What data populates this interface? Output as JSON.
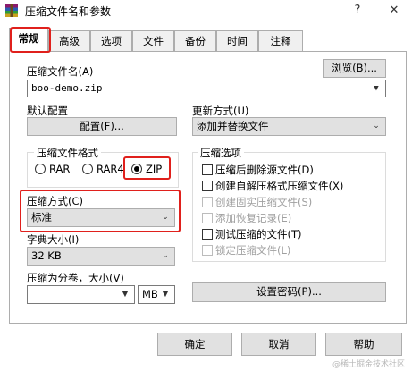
{
  "window": {
    "title": "压缩文件名和参数",
    "help_glyph": "?",
    "close_glyph": "✕"
  },
  "tabs": [
    {
      "label": "常规",
      "active": true
    },
    {
      "label": "高级"
    },
    {
      "label": "选项"
    },
    {
      "label": "文件"
    },
    {
      "label": "备份"
    },
    {
      "label": "时间"
    },
    {
      "label": "注释"
    }
  ],
  "archive_name": {
    "label": "压缩文件名(A)",
    "value": "boo-demo.zip",
    "browse_label": "浏览(B)..."
  },
  "default_profile": {
    "label": "默认配置",
    "profiles_button": "配置(F)..."
  },
  "update_mode": {
    "label": "更新方式(U)",
    "value": "添加并替换文件"
  },
  "archive_format": {
    "title": "压缩文件格式",
    "options": [
      {
        "label": "RAR",
        "selected": false
      },
      {
        "label": "RAR4",
        "selected": false
      },
      {
        "label": "ZIP",
        "selected": true
      }
    ]
  },
  "compression_method": {
    "label": "压缩方式(C)",
    "value": "标准"
  },
  "dictionary_size": {
    "label": "字典大小(I)",
    "value": "32 KB"
  },
  "split_volumes": {
    "label": "压缩为分卷，大小(V)",
    "value": "",
    "unit": "MB"
  },
  "archive_options": {
    "title": "压缩选项",
    "items": [
      {
        "label": "压缩后删除源文件(D)",
        "checked": false,
        "enabled": true
      },
      {
        "label": "创建自解压格式压缩文件(X)",
        "checked": false,
        "enabled": true
      },
      {
        "label": "创建固实压缩文件(S)",
        "checked": false,
        "enabled": false
      },
      {
        "label": "添加恢复记录(E)",
        "checked": false,
        "enabled": false
      },
      {
        "label": "测试压缩的文件(T)",
        "checked": false,
        "enabled": true
      },
      {
        "label": "锁定压缩文件(L)",
        "checked": false,
        "enabled": false
      }
    ]
  },
  "set_password_button": "设置密码(P)...",
  "buttons": {
    "ok": "确定",
    "cancel": "取消",
    "help": "帮助"
  },
  "watermark": "@稀土掘金技术社区",
  "colors": {
    "highlight": "#e0201c",
    "button_face": "#e1e1e1",
    "border": "#adadad"
  }
}
